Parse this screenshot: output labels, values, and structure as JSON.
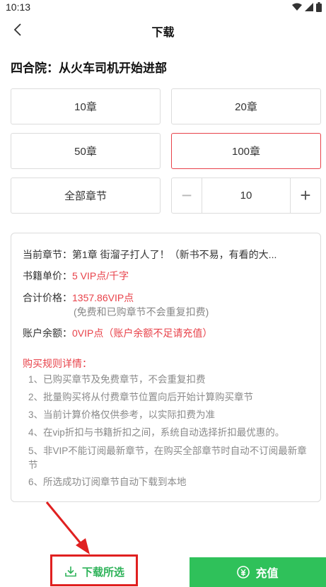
{
  "status_bar": {
    "time": "10:13"
  },
  "header": {
    "title": "下载"
  },
  "book": {
    "title": "四合院：从火车司机开始进部"
  },
  "options": [
    {
      "label": "10章"
    },
    {
      "label": "20章"
    },
    {
      "label": "50章"
    },
    {
      "label": "100章",
      "selected": true
    },
    {
      "label": "全部章节"
    }
  ],
  "stepper": {
    "minus": "−",
    "value": "10",
    "plus": "+"
  },
  "info": {
    "current_chapter_label": "当前章节：",
    "current_chapter_value": "第1章 街溜子打人了！（新书不易，有看的大...",
    "unit_price_label": "书籍单价：",
    "unit_price_value": "5 VIP点/千字",
    "total_label": "合计价格：",
    "total_value": "1357.86VIP点",
    "total_note": "(免费和已购章节不会重复扣费)",
    "balance_label": "账户余额：",
    "balance_value": "0VIP点（账户余额不足请充值）"
  },
  "rules": {
    "title": "购买规则详情：",
    "items": [
      "1、已购买章节及免费章节，不会重复扣费",
      "2、批量购买将从付费章节位置向后开始计算购买章节",
      "3、当前计算价格仅供参考，以实际扣费为准",
      "4、在vip折扣与书籍折扣之间，系统自动选择折扣最优惠的。",
      "5、非VIP不能订阅最新章节，在购买全部章节时自动不订阅最新章节",
      "6、所选成功订阅章节自动下载到本地"
    ]
  },
  "bottom": {
    "download_label": "下载所选",
    "recharge_label": "充值"
  },
  "colors": {
    "accent_red": "#e8424a",
    "green": "#2fc15a",
    "highlight": "#e02020"
  }
}
